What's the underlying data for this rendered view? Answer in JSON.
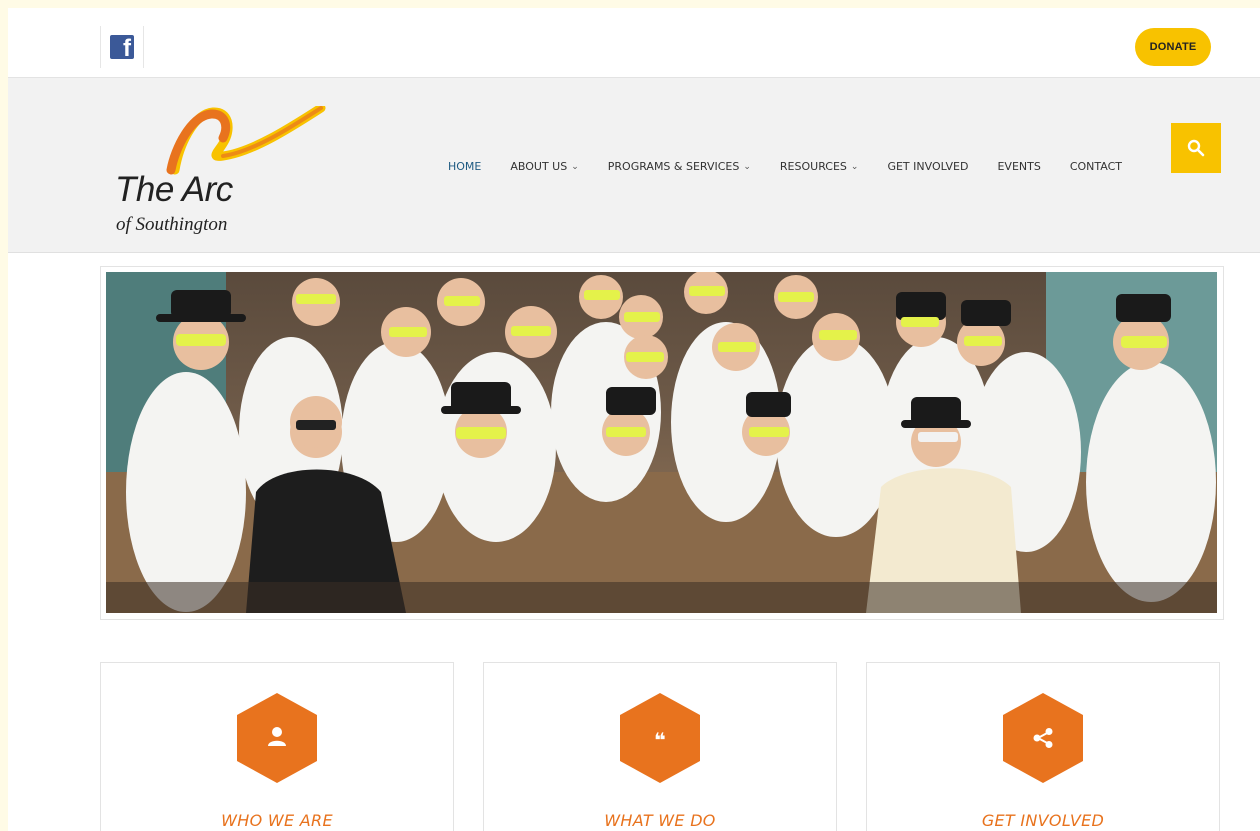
{
  "topbar": {
    "facebook_icon": "facebook-icon",
    "donate_label": "DONATE"
  },
  "logo": {
    "title": "The Arc",
    "subtitle": "of Southington"
  },
  "nav": {
    "items": [
      {
        "label": "HOME",
        "active": true,
        "dropdown": false
      },
      {
        "label": "ABOUT US",
        "active": false,
        "dropdown": true
      },
      {
        "label": "PROGRAMS & SERVICES",
        "active": false,
        "dropdown": true
      },
      {
        "label": "RESOURCES",
        "active": false,
        "dropdown": true
      },
      {
        "label": "GET INVOLVED",
        "active": false,
        "dropdown": false
      },
      {
        "label": "EVENTS",
        "active": false,
        "dropdown": false
      },
      {
        "label": "CONTACT",
        "active": false,
        "dropdown": false
      }
    ],
    "chevron": "⌄",
    "search_icon": "search-icon"
  },
  "cards": [
    {
      "title": "WHO WE ARE",
      "icon": "user-icon"
    },
    {
      "title": "WHAT WE DO",
      "icon": "quote-icon"
    },
    {
      "title": "GET INVOLVED",
      "icon": "share-icon"
    }
  ],
  "colors": {
    "accent_yellow": "#f8c200",
    "accent_orange": "#e8731e",
    "nav_active": "#1e5a82",
    "facebook_blue": "#3b5998"
  }
}
